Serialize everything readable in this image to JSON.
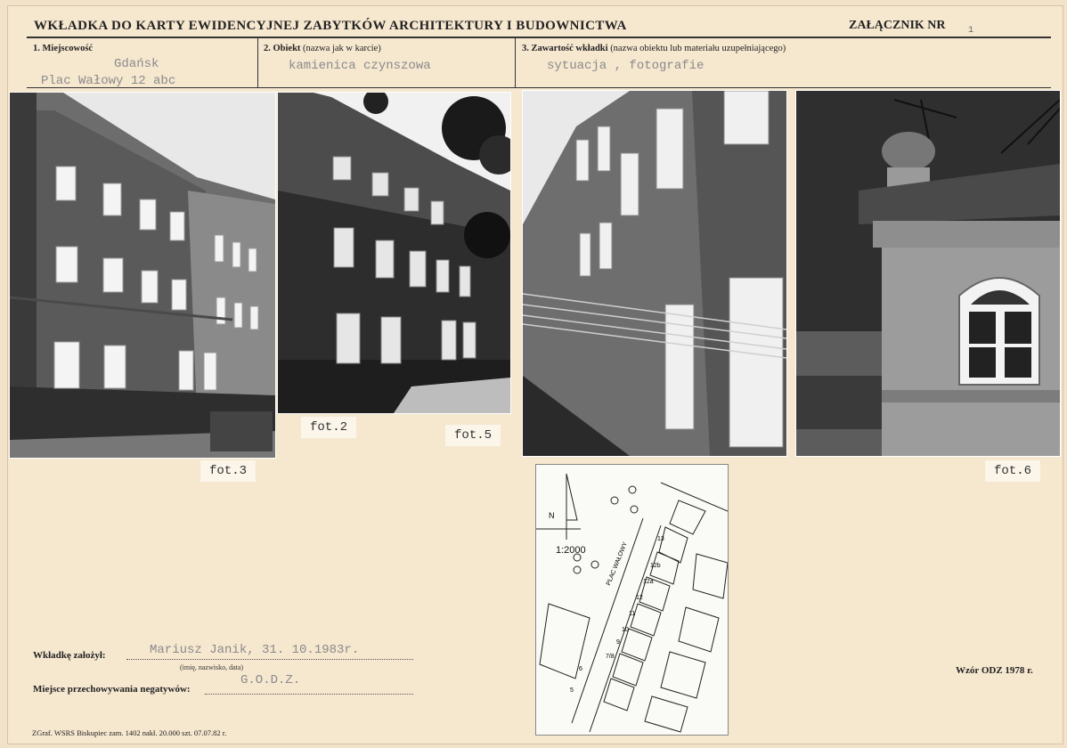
{
  "header": {
    "title": "WKŁADKA DO KARTY EWIDENCYJNEJ ZABYTKÓW ARCHITEKTURY I BUDOWNICTWA",
    "attachment_label": "ZAŁĄCZNIK NR",
    "attachment_number": "1"
  },
  "fields": {
    "place_label": "1. Miejscowość",
    "place_city": "Gdańsk",
    "place_address": "Plac Wałowy 12 abc",
    "object_label": "2. Obiekt",
    "object_label_sub": "(nazwa jak w karcie)",
    "object_value": "kamienica czynszowa",
    "contents_label": "3. Zawartość wkładki",
    "contents_label_sub": "(nazwa obiektu lub materiału uzupełniającego)",
    "contents_value": "sytuacja , fotografie"
  },
  "photos": [
    {
      "caption": "fot.3"
    },
    {
      "caption": "fot.2"
    },
    {
      "caption": "fot.5"
    },
    {
      "caption": "fot.6"
    }
  ],
  "map": {
    "scale": "1:2000",
    "north": "N",
    "street": "PLAC WAŁOWY",
    "numbers": [
      "5",
      "6",
      "7/8",
      "9",
      "10",
      "11",
      "12",
      "12a",
      "12b",
      "13"
    ]
  },
  "footer": {
    "founder_label": "Wkładkę założył:",
    "founder_value": "Mariusz Janik, 31. 10.1983r.",
    "founder_hint": "(imię, nazwisko, data)",
    "storage_label": "Miejsce przechowywania negatywów:",
    "storage_value": "G.O.D.Z.",
    "model": "Wzór ODZ 1978 r.",
    "printer": "ZGraf. WSRS Biskupiec zam. 1402 nakł. 20.000 szt. 07.07.82 r."
  }
}
